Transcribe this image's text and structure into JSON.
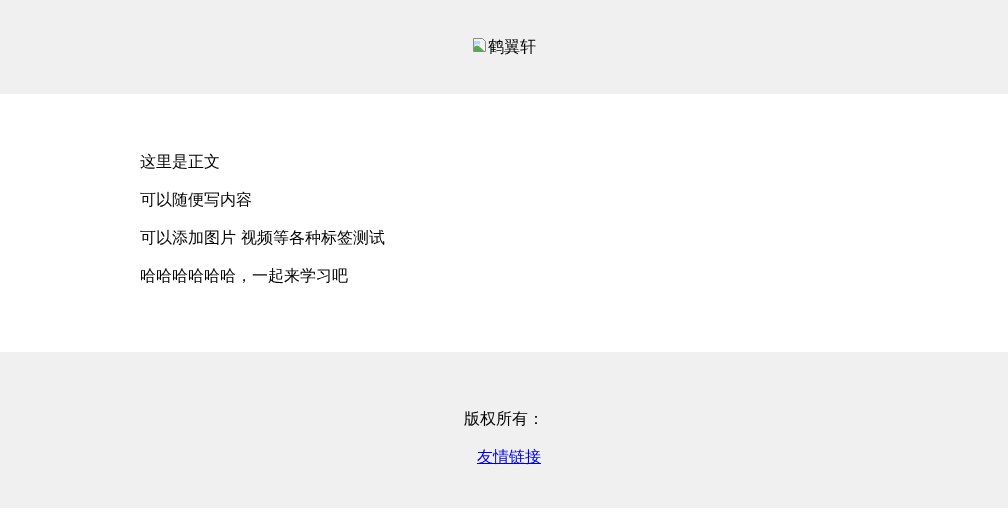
{
  "header": {
    "image_alt": "鹤翼轩"
  },
  "content": {
    "paragraphs": [
      "这里是正文",
      "可以随便写内容",
      "可以添加图片 视频等各种标签测试",
      "哈哈哈哈哈哈，一起来学习吧"
    ]
  },
  "footer": {
    "copyright": "版权所有：",
    "link": "友情链接"
  }
}
